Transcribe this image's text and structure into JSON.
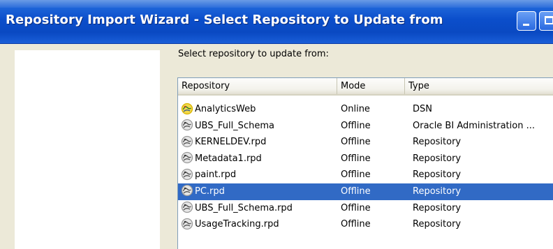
{
  "window": {
    "title": "Repository Import Wizard - Select Repository to Update from"
  },
  "instruction": "Select repository to update from:",
  "list": {
    "columns": [
      "Repository",
      "Mode",
      "Type"
    ],
    "rows": [
      {
        "name": "AnalyticsWeb",
        "mode": "Online",
        "type": "DSN",
        "icon": "online-repository-icon"
      },
      {
        "name": "UBS_Full_Schema",
        "mode": "Offline",
        "type": "Oracle BI Administration ...",
        "icon": "offline-repository-icon"
      },
      {
        "name": "KERNELDEV.rpd",
        "mode": "Offline",
        "type": "Repository",
        "icon": "offline-repository-icon"
      },
      {
        "name": "Metadata1.rpd",
        "mode": "Offline",
        "type": "Repository",
        "icon": "offline-repository-icon"
      },
      {
        "name": "paint.rpd",
        "mode": "Offline",
        "type": "Repository",
        "icon": "offline-repository-icon"
      },
      {
        "name": "PC.rpd",
        "mode": "Offline",
        "type": "Repository",
        "icon": "offline-repository-icon"
      },
      {
        "name": "UBS_Full_Schema.rpd",
        "mode": "Offline",
        "type": "Repository",
        "icon": "offline-repository-icon"
      },
      {
        "name": "UsageTracking.rpd",
        "mode": "Offline",
        "type": "Repository",
        "icon": "offline-repository-icon"
      }
    ],
    "selected_index": 5
  },
  "colors": {
    "titlebar": "#0a49c2",
    "selection": "#316ac5",
    "online_icon": "#d9b400",
    "offline_icon": "#9a9a9a"
  }
}
